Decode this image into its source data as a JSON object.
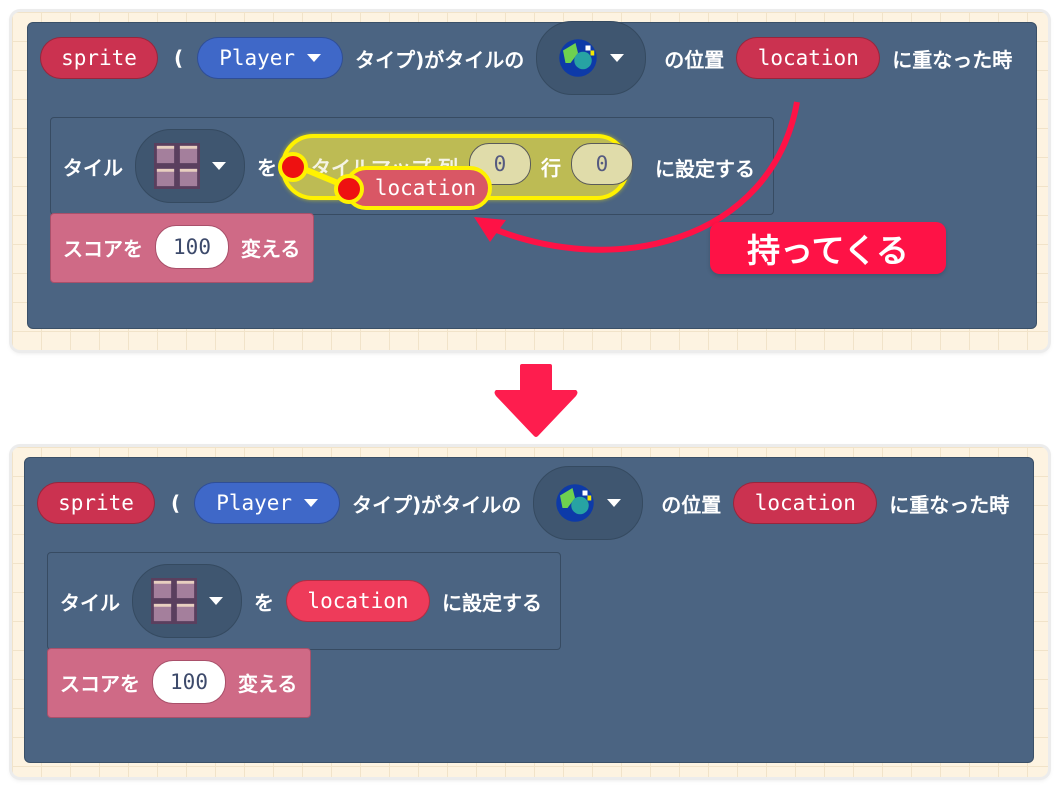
{
  "before": {
    "event_block": {
      "sprite_var": "sprite",
      "paren_open": "(",
      "kind_value": "Player",
      "text_type_tile": "タイプ)がタイルの",
      "tile_image": "earth-tile-icon",
      "text_position": "の位置",
      "location_var": "location",
      "text_when_overlap": "に重なった時"
    },
    "set_tile_block": {
      "label_tile": "タイル",
      "tile_image": "brick-tile-icon",
      "label_wo": "を",
      "tilemap_label": "タイルマップ 列",
      "col_value": "0",
      "row_label": "行",
      "row_value": "0",
      "label_set": "に設定する"
    },
    "dragged_block": {
      "label": "location"
    },
    "score_block": {
      "label_score": "スコアを",
      "value": "100",
      "label_change": "変える"
    },
    "callout": {
      "text": "持ってくる"
    }
  },
  "after": {
    "event_block": {
      "sprite_var": "sprite",
      "paren_open": "(",
      "kind_value": "Player",
      "text_type_tile": "タイプ)がタイルの",
      "tile_image": "earth-tile-icon",
      "text_position": "の位置",
      "location_var": "location",
      "text_when_overlap": "に重なった時"
    },
    "set_tile_block": {
      "label_tile": "タイル",
      "tile_image": "brick-tile-icon",
      "label_wo": "を",
      "location_var": "location",
      "label_set": "に設定する"
    },
    "score_block": {
      "label_score": "スコアを",
      "value": "100",
      "label_change": "変える"
    }
  },
  "colors": {
    "accent": "#fe1246",
    "event_block": "#4b6482",
    "variable": "#cb3250",
    "kind": "#3f68c8",
    "score_block": "#cf6a86",
    "tilemap_block": "#bdbb54",
    "highlight": "#fff200"
  }
}
